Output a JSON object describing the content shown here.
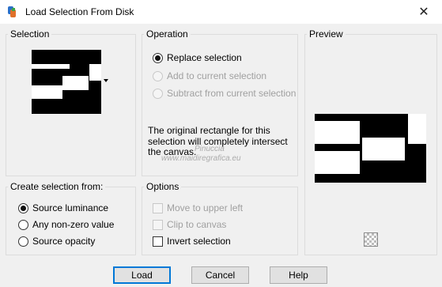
{
  "window": {
    "title": "Load Selection From Disk",
    "close_glyph": "✕",
    "app_icon": "paint-palette-icon"
  },
  "selection_group": {
    "title": "Selection"
  },
  "operation_group": {
    "title": "Operation",
    "options": [
      {
        "label": "Replace selection",
        "checked": true,
        "enabled": true
      },
      {
        "label": "Add to current selection",
        "checked": false,
        "enabled": false
      },
      {
        "label": "Subtract from current selection",
        "checked": false,
        "enabled": false
      }
    ],
    "info_text": "The original rectangle for this selection will completely intersect the canvas."
  },
  "preview_group": {
    "title": "Preview",
    "checkerboard_icon": "transparency-checkerboard-icon"
  },
  "create_group": {
    "title": "Create selection from:",
    "options": [
      {
        "label": "Source luminance",
        "checked": true
      },
      {
        "label": "Any non-zero value",
        "checked": false
      },
      {
        "label": "Source opacity",
        "checked": false
      }
    ]
  },
  "options_group": {
    "title": "Options",
    "items": [
      {
        "label": "Move to upper left",
        "checked": false,
        "enabled": false
      },
      {
        "label": "Clip to canvas",
        "checked": false,
        "enabled": false
      },
      {
        "label": "Invert selection",
        "checked": false,
        "enabled": true
      }
    ]
  },
  "watermark": {
    "name": "Pinuccia",
    "url": "www.maidiregrafica.eu"
  },
  "buttons": {
    "load": "Load",
    "cancel": "Cancel",
    "help": "Help"
  }
}
